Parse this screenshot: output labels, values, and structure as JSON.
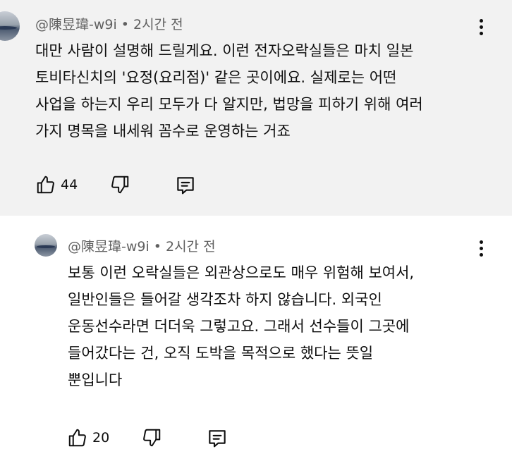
{
  "comment": {
    "author": "@陳昱瑋-w9i",
    "separator": "•",
    "time": "2시간 전",
    "lines": [
      "대만 사람이 설명해 드릴게요. 이런 전자오락실들은 마치 일본",
      "토비타신치의 '요정(요리점)' 같은 곳이에요. 실제로는 어떤",
      "사업을 하는지 우리 모두가 다 알지만, 법망을 피하기 위해 여러",
      "가지 명목을 내세워 꼼수로 운영하는 거죠"
    ],
    "likes": "44"
  },
  "reply": {
    "author": "@陳昱瑋-w9i",
    "separator": "•",
    "time": "2시간 전",
    "lines": [
      "보통 이런 오락실들은 외관상으로도 매우 위험해 보여서,",
      "일반인들은 들어갈 생각조차 하지 않습니다. 외국인",
      "운동선수라면 더더욱 그렇고요. 그래서 선수들이 그곳에",
      "들어갔다는 건, 오직 도박을 목적으로 했다는 뜻일",
      "뿐입니다"
    ],
    "likes": "20"
  },
  "icons": {
    "like": "thumbs-up-icon",
    "dislike": "thumbs-down-icon",
    "reply": "comment-reply-icon",
    "more": "more-vert-icon"
  },
  "colors": {
    "highlight_bg": "#f2f2f2",
    "meta_text": "#606060",
    "text": "#0f0f0f"
  }
}
